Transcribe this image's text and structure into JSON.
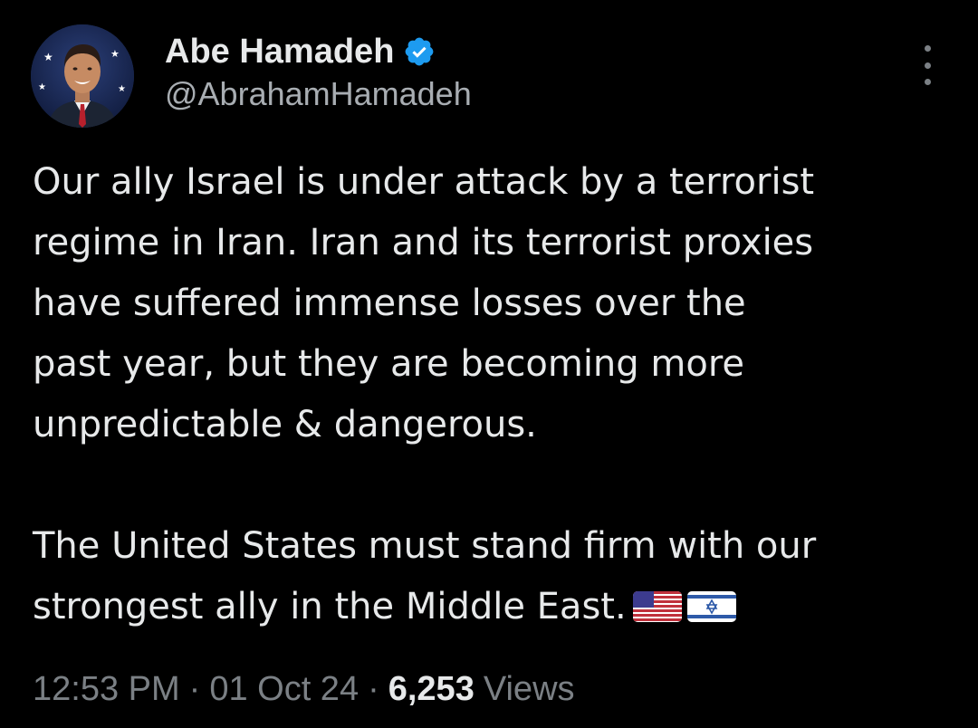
{
  "author": {
    "display_name": "Abe Hamadeh",
    "handle": "@AbrahamHamadeh",
    "verified": true,
    "verified_color": "#1d9bf0"
  },
  "tweet": {
    "paragraph_1": "Our ally Israel is under attack by a terrorist\nregime in Iran. Iran and its terrorist proxies\nhave suffered immense losses over the\npast year, but they are becoming more\nunpredictable & dangerous.",
    "paragraph_2": "The United States must stand firm with our\nstrongest ally in the Middle East.",
    "emojis": [
      "us-flag-icon",
      "israel-flag-icon"
    ]
  },
  "meta": {
    "time": "12:53 PM",
    "date": "01 Oct 24",
    "separator": "·",
    "views_count": "6,253",
    "views_label": "Views"
  },
  "icons": {
    "more": "more-vertical-icon",
    "verified": "verified-badge-icon"
  },
  "colors": {
    "background": "#000000",
    "text_primary": "#e7e9ea",
    "text_secondary": "#7b8085",
    "accent": "#1d9bf0"
  }
}
